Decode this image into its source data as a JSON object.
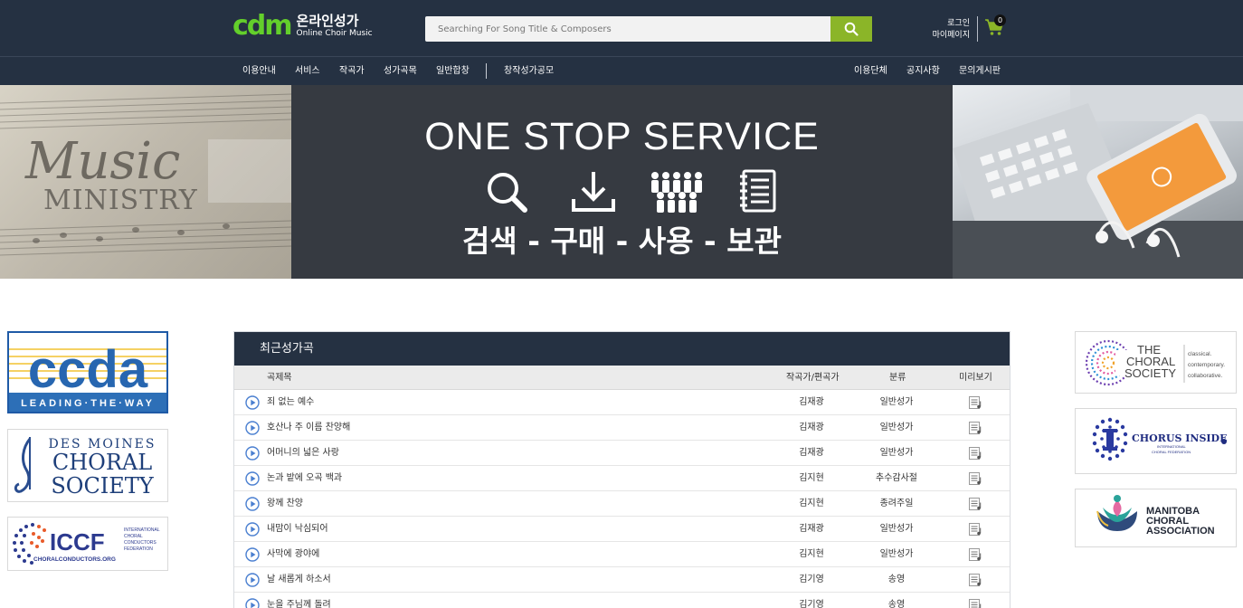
{
  "header": {
    "logo_mark": "cdm",
    "logo_title": "온라인성가",
    "logo_subtitle": "Online Choir Music",
    "search_placeholder": "Searching For Song Title & Composers",
    "login": "로그인",
    "mypage": "마이페이지",
    "cart_count": "0"
  },
  "nav": {
    "left": [
      "이용안내",
      "서비스",
      "작곡가",
      "성가곡목",
      "일반합창"
    ],
    "contest": "창작성가공모",
    "right": [
      "이용단체",
      "공지사항",
      "문의게시판"
    ]
  },
  "banner": {
    "left_script": "Music",
    "left_word": "MINISTRY",
    "title": "ONE STOP SERVICE",
    "subtitle": "검색 - 구매 - 사용 - 보관"
  },
  "side_left": [
    {
      "name": "ccda",
      "main": "ccda",
      "tagline": "LEADING·THE·WAY"
    },
    {
      "name": "des-moines",
      "line1": "DES MOINES",
      "line2": "CHORAL",
      "line3": "SOCIETY"
    },
    {
      "name": "iccf",
      "main": "ICCF",
      "small1": "INTERNATIONAL",
      "small2": "CHORAL",
      "small3": "CONDUCTORS",
      "small4": "FEDERATION",
      "url": "CHORALCONDUCTORS.ORG"
    }
  ],
  "side_right": [
    {
      "name": "the-choral-society",
      "line1": "THE",
      "line2": "CHORAL",
      "line3": "SOCIETY",
      "tag1": "classical.",
      "tag2": "contemporary.",
      "tag3": "collaborative."
    },
    {
      "name": "chorus-inside",
      "main": "CHORUS INSIDE",
      "small1": "INTERNATIONAL",
      "small2": "CHORAL FEDERATION"
    },
    {
      "name": "manitoba",
      "line1": "MANITOBA",
      "line2": "CHORAL",
      "line3": "ASSOCIATION"
    }
  ],
  "songs": {
    "panel_title": "최근성가곡",
    "columns": {
      "title": "곡제목",
      "composer": "작곡가/편곡가",
      "category": "분류",
      "preview": "미리보기"
    },
    "rows": [
      {
        "title": "죄 없는 예수",
        "composer": "김재광",
        "category": "일반성가"
      },
      {
        "title": "호산나 주 이름 찬양해",
        "composer": "김재광",
        "category": "일반성가"
      },
      {
        "title": "어머니의 넓은 사랑",
        "composer": "김재광",
        "category": "일반성가"
      },
      {
        "title": "논과 밭에 오곡 백과",
        "composer": "김지현",
        "category": "추수감사절"
      },
      {
        "title": "왕께 찬양",
        "composer": "김지현",
        "category": "종려주일"
      },
      {
        "title": "내맘이 낙심되어",
        "composer": "김재광",
        "category": "일반성가"
      },
      {
        "title": "사막에 광야에",
        "composer": "김지현",
        "category": "일반성가"
      },
      {
        "title": "날 새롭게 하소서",
        "composer": "김기영",
        "category": "송영"
      },
      {
        "title": "눈을 주님께 돌려",
        "composer": "김기영",
        "category": "송영"
      }
    ]
  },
  "colors": {
    "header_bg": "#253142",
    "accent_green": "#8bb528",
    "logo_green": "#63cf2b",
    "banner_bg": "#363a41"
  }
}
